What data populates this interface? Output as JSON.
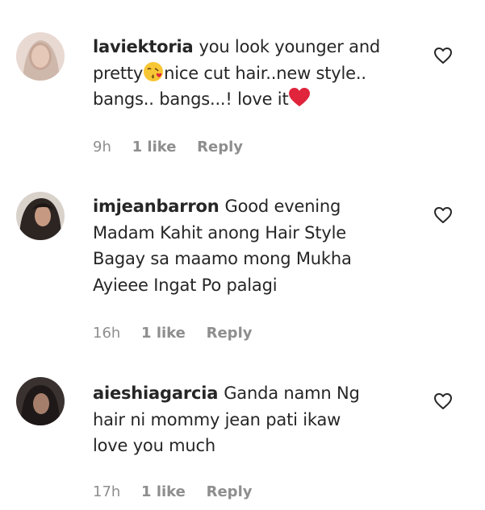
{
  "comments": [
    {
      "username": "laviektoria",
      "text_lines": [
        "you look younger and",
        "pretty",
        "nice cut hair..new style..",
        "bangs.. bangs...! love it"
      ],
      "emojis": [
        "kissing-face-emoji",
        "red-heart-emoji"
      ],
      "time": "9h",
      "likes": "1 like",
      "reply_label": "Reply"
    },
    {
      "username": "imjeanbarron",
      "text_lines": [
        "Good evening",
        "Madam Kahit anong Hair Style",
        "Bagay sa maamo mong Mukha",
        "Ayieee Ingat Po palagi"
      ],
      "time": "16h",
      "likes": "1 like",
      "reply_label": "Reply"
    },
    {
      "username": "aieshiagarcia",
      "text_lines": [
        "Ganda namn Ng",
        "hair ni mommy jean pati ikaw",
        "love you much"
      ],
      "time": "17h",
      "likes": "1 like",
      "reply_label": "Reply"
    }
  ],
  "icons": {
    "like": "heart-outline-icon"
  },
  "colors": {
    "text": "#262626",
    "meta": "#8e8e8e",
    "heart_emoji": "#e0243c"
  }
}
